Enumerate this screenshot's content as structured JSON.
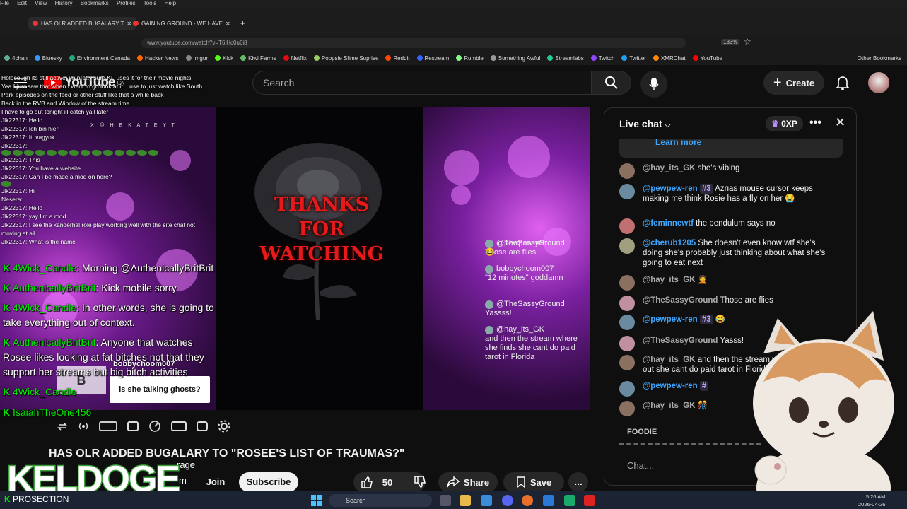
{
  "browser": {
    "menu": [
      "File",
      "Edit",
      "View",
      "History",
      "Bookmarks",
      "Profiles",
      "Tools",
      "Help"
    ],
    "tabs": [
      "HAS OLR ADDED BUGALARY T",
      "GAINING GROUND - WE HAVE"
    ],
    "url": "www.youtube.com/watch?v=T6lHc0u6i8",
    "zoom": "133%",
    "bookmarks": [
      "4chan",
      "Bluesky",
      "Environment Canada",
      "Hacker News",
      "Imgur",
      "Kick",
      "Kiwi Farms",
      "Netflix",
      "Poopsie Slime Suprise",
      "Reddit",
      "Restream",
      "Rumble",
      "Something Awful",
      "Streamlabs",
      "Twitch",
      "Twitter",
      "XMRChat",
      "YouTube"
    ],
    "other_bookmarks": "Other Bookmarks"
  },
  "youtube": {
    "logo": "YouTube",
    "region": "CA",
    "search_placeholder": "Search",
    "create": "Create"
  },
  "video": {
    "watermark": "X @ H E K A T E Y T",
    "thanks": [
      "THANKS",
      "FOR",
      "WATCHING"
    ],
    "title": "HAS OLR ADDED BUGALARY TO \"ROSEE'S LIST OF TRAUMAS?\"",
    "box_b": "B",
    "box_bobby": "bobbychoom007",
    "box_caption": "is she talking ghosts?",
    "inset_chat": [
      {
        "name": "@TheSassyGround",
        "text": "Those are flies"
      },
      {
        "name": "@pewpew-ren",
        "text": "😂"
      },
      {
        "name": "bobbychoom007",
        "text": "\"12 minutes\" goddamn"
      },
      {
        "name": "@TheSassyGround",
        "text": "Yassss!"
      },
      {
        "name": "@hay_its_GK",
        "text": "and then the stream where she finds she cant do paid tarot in Florida"
      }
    ]
  },
  "overlay_chat": [
    "Holocough its still active, im pretty sure KF uses it for their movie nights",
    "Yea I just saw that when I went to go look at it. I use to just watch like South Park episodes on the feed or other stuff like that a while back",
    "Back in the RVB and Window of the stream time",
    "I have to go out tonight ill catch yall later",
    "Jlk22317: Hello",
    "Jlk22317: Ich bin hier",
    "Jlk22317: Itt vagyok",
    "Jlk22317:",
    "Jlk22317: This",
    "Jlk22317: You have a website",
    "Jlk22317: Can I be made a mod on here?",
    "Jlk22317: Hi",
    "Nesera:",
    "Jlk22317: Hello",
    "Jlk22317: yay I'm a mod",
    "Jlk22317: I see the xanderhal role play working well with the site chat not moving at all",
    "Jlk22317: What is the name"
  ],
  "kick_chat": [
    {
      "name": "4Wick_Candle",
      "text": "Morning @AuthenicallyBritBrit"
    },
    {
      "name": "AuthenicallyBritBrit",
      "text": "Kick mobile sorry"
    },
    {
      "name": "4Wick_Candle",
      "text": "In other words, she is going to take everything out of context."
    },
    {
      "name": "AuthenicallyBritBrit",
      "text": "Anyone that watches Rosee likes looking at fat bitches not that they support her streams but big bitch activities"
    },
    {
      "name": "4Wick_Candle",
      "text": ""
    },
    {
      "name": "IsaiahTheOne456",
      "text": ""
    }
  ],
  "kick_bottom": "PROSECTION",
  "keldoge": "KELDOGE",
  "actions": {
    "join": "Join",
    "subscribe": "Subscribe",
    "likes": "50",
    "share": "Share",
    "save": "Save",
    "more": "..."
  },
  "channel_partial": [
    "rage",
    "m"
  ],
  "live_chat": {
    "title": "Live chat",
    "xp": "0XP",
    "learn_more": "Learn more",
    "messages": [
      {
        "name": "@hay_its_GK",
        "badge": "",
        "text": "she's vibing"
      },
      {
        "name": "@pewpew-ren",
        "badge": "#3",
        "text": "Azrias mouse cursor keeps making me think Rosie has a fly on her 😭"
      },
      {
        "name": "@feminnewtf",
        "badge": "",
        "text": "the pendulum says no"
      },
      {
        "name": "@cherub1205",
        "badge": "",
        "text": "She doesn't even know wtf she's doing she's probably just thinking about what she's going to eat next"
      },
      {
        "name": "@hay_its_GK",
        "badge": "",
        "text": "🤦"
      },
      {
        "name": "@TheSassyGround",
        "badge": "",
        "text": "Those are flies"
      },
      {
        "name": "@pewpew-ren",
        "badge": "#3",
        "text": "😂"
      },
      {
        "name": "@TheSassyGround",
        "badge": "",
        "text": "Yasss!"
      },
      {
        "name": "@hay_its_GK",
        "badge": "",
        "text": "and then the stream where she finds out she cant do paid tarot in Florida"
      },
      {
        "name": "@pewpew-ren",
        "badge": "#",
        "text": ""
      },
      {
        "name": "@hay_its_GK",
        "badge": "",
        "text": "🎊"
      }
    ],
    "section": "FOODIE",
    "input_placeholder": "Chat..."
  },
  "taskbar": {
    "search": "Search",
    "time": "5:26 AM",
    "date": "2026-04-26"
  }
}
